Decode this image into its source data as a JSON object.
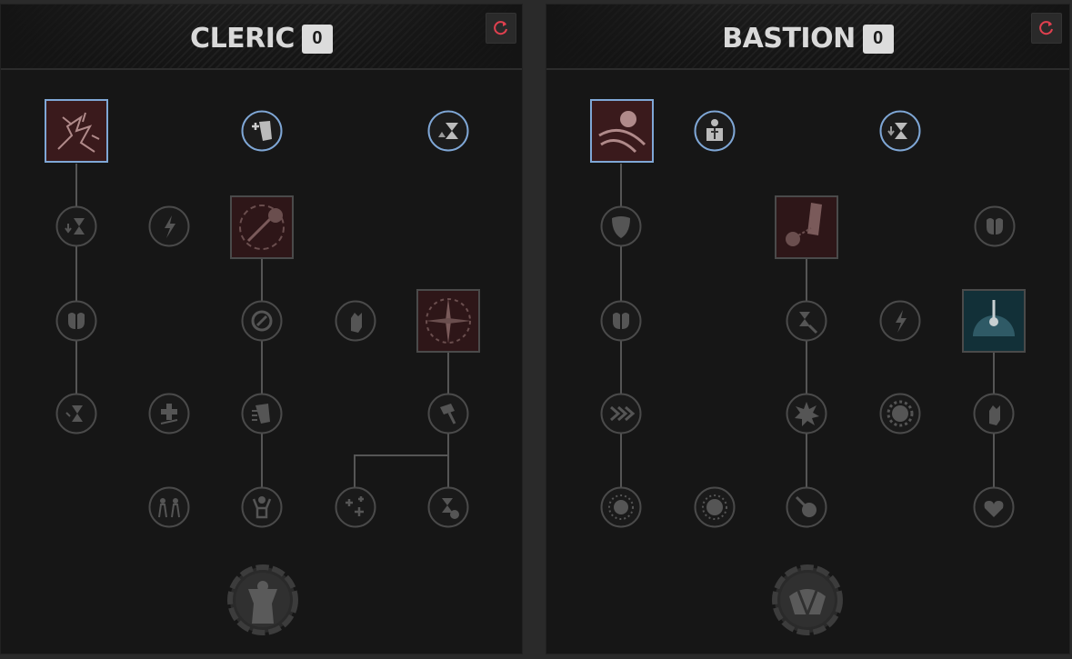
{
  "trees": [
    {
      "id": "cleric",
      "title": "CLERIC",
      "points": "0",
      "reset_icon": "reset-icon",
      "accent": "#e0404f"
    },
    {
      "id": "bastion",
      "title": "BASTION",
      "points": "0",
      "reset_icon": "reset-icon",
      "accent": "#e0404f"
    }
  ],
  "colors": {
    "panel_bg": "#161616",
    "node_border": "#4a4a4a",
    "selected_border": "#7fa7d6",
    "active_tile_bg": "#3a1a1c",
    "blue_tile_bg": "#123038",
    "line": "#555555"
  },
  "node_icons": {
    "cleric": [
      "lightning-strike-icon",
      "heal-hand-icon",
      "hourglass-cooldown-icon",
      "hourglass-down-icon",
      "lightning-icon",
      "hammer-spin-icon",
      "body-armor-icon",
      "hammer-circle-icon",
      "raise-hand-icon",
      "holy-burst-icon",
      "hourglass-icon",
      "heal-cross-icon",
      "hammer-swing-icon",
      "hammer-icon",
      "allies-icon",
      "revive-icon",
      "healing-plus-icon",
      "hourglass-hit-icon",
      "ultimate-cleric-icon"
    ],
    "bastion": [
      "shield-slam-icon",
      "armored-torso-icon",
      "hourglass-cooldown-icon",
      "shield-icon",
      "chained-hammer-icon",
      "armor-plates-icon",
      "body-armor-icon",
      "hourglass-hammer-icon",
      "lightning-icon",
      "dome-shield-icon",
      "dash-arrows-icon",
      "impact-burst-icon",
      "gear-burst-icon",
      "raise-hand-icon",
      "spiky-burst-icon",
      "spiky-burst-icon",
      "hammer-burst-icon",
      "heart-hands-icon",
      "ultimate-bastion-icon"
    ]
  }
}
